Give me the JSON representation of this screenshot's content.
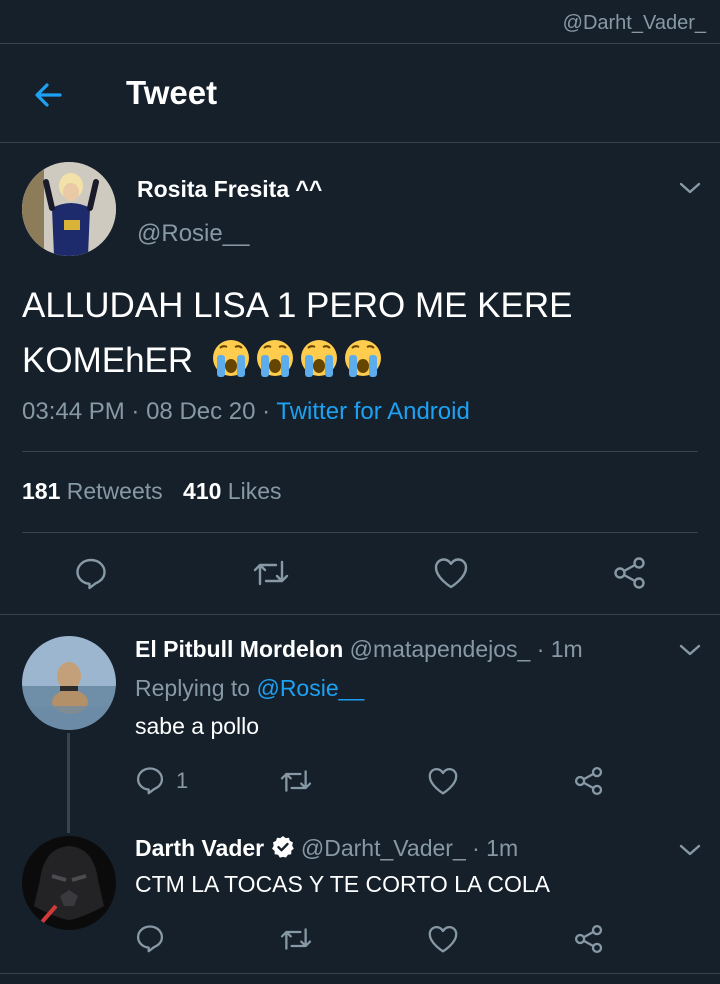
{
  "watermark": "@Darht_Vader_",
  "header": {
    "title": "Tweet"
  },
  "tweet": {
    "author_name": "Rosita Fresita ^^",
    "author_handle": "@Rosie__",
    "text_line1": "ALLUDAH LISA 1 PERO ME KERE",
    "text_line2": "KOMEhER",
    "emoji": "loudly-crying-face x4",
    "time": "03:44 PM",
    "date": "08 Dec 20",
    "sep1": "·",
    "sep2": "·",
    "source": "Twitter for Android",
    "retweets_count": "181",
    "retweets_label": "Retweets",
    "likes_count": "410",
    "likes_label": "Likes"
  },
  "replies": [
    {
      "name": "El Pitbull Mordelon",
      "handle": "@matapendejos_",
      "time": "· 1m",
      "replying_prefix": "Replying to",
      "replying_handle": "@Rosie__",
      "text": "sabe a pollo",
      "reply_count": "1"
    },
    {
      "name": "Darth Vader",
      "verified": true,
      "handle": "@Darht_Vader_",
      "time": "· 1m",
      "text": "CTM LA TOCAS Y TE CORTO LA COLA"
    }
  ],
  "colors": {
    "bg": "#15202b",
    "muted": "#8899a6",
    "accent": "#1da1f2",
    "divider": "#38444d"
  }
}
